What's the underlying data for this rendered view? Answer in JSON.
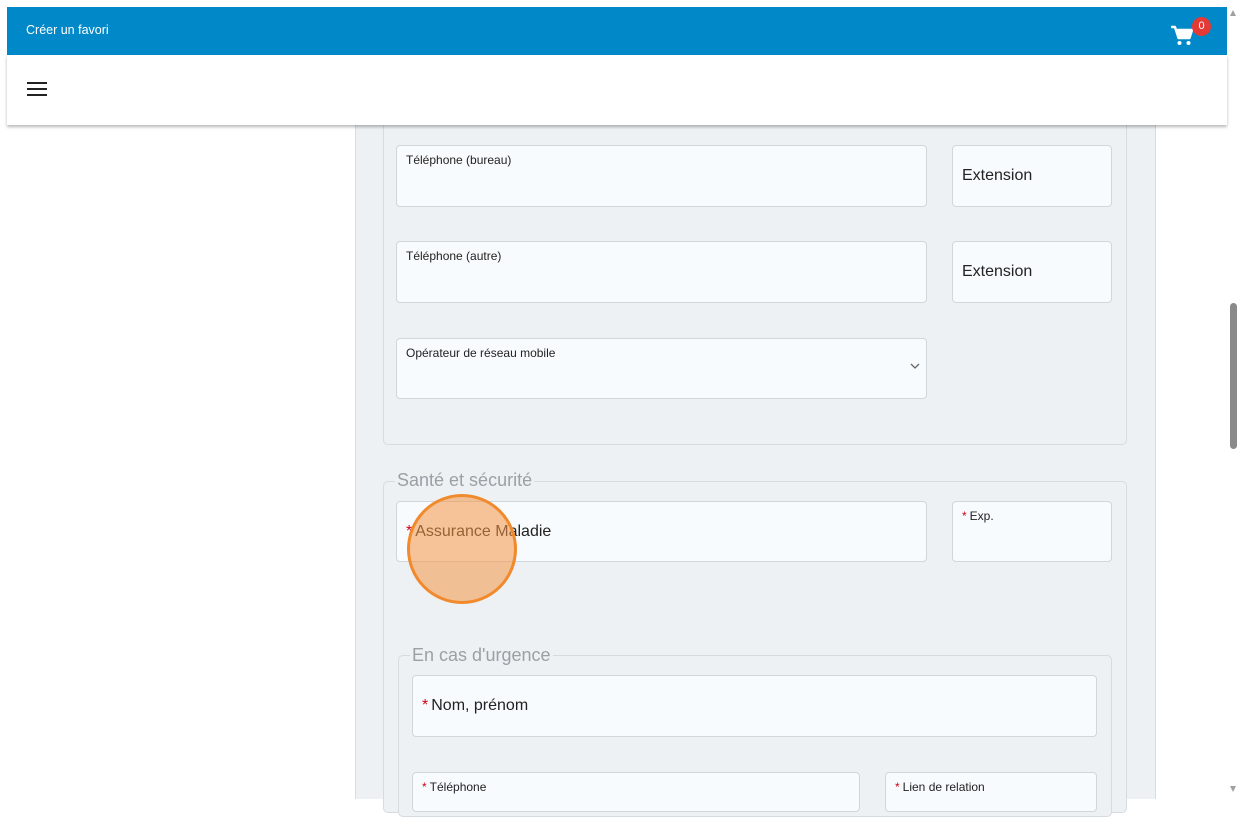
{
  "header": {
    "title": "Créer un favori",
    "cart_icon": "cart-icon",
    "cart_count": "0",
    "brand_color": "#0088c9",
    "badge_color": "#e53935"
  },
  "nav": {
    "menu_icon": "hamburger-menu-icon"
  },
  "contact": {
    "phone_office_label": "Téléphone (bureau)",
    "phone_office_ext_label": "Extension",
    "phone_other_label": "Téléphone (autre)",
    "phone_other_ext_label": "Extension",
    "mobile_operator_label": "Opérateur de réseau mobile"
  },
  "health": {
    "legend": "Santé et sécurité",
    "required_mark": "*",
    "insurance_label": "Assurance Maladie",
    "exp_label": "Exp."
  },
  "emergency": {
    "legend": "En cas d'urgence",
    "required_mark": "*",
    "name_label": "Nom, prénom",
    "phone_label": "Téléphone",
    "relation_label": "Lien de relation"
  }
}
